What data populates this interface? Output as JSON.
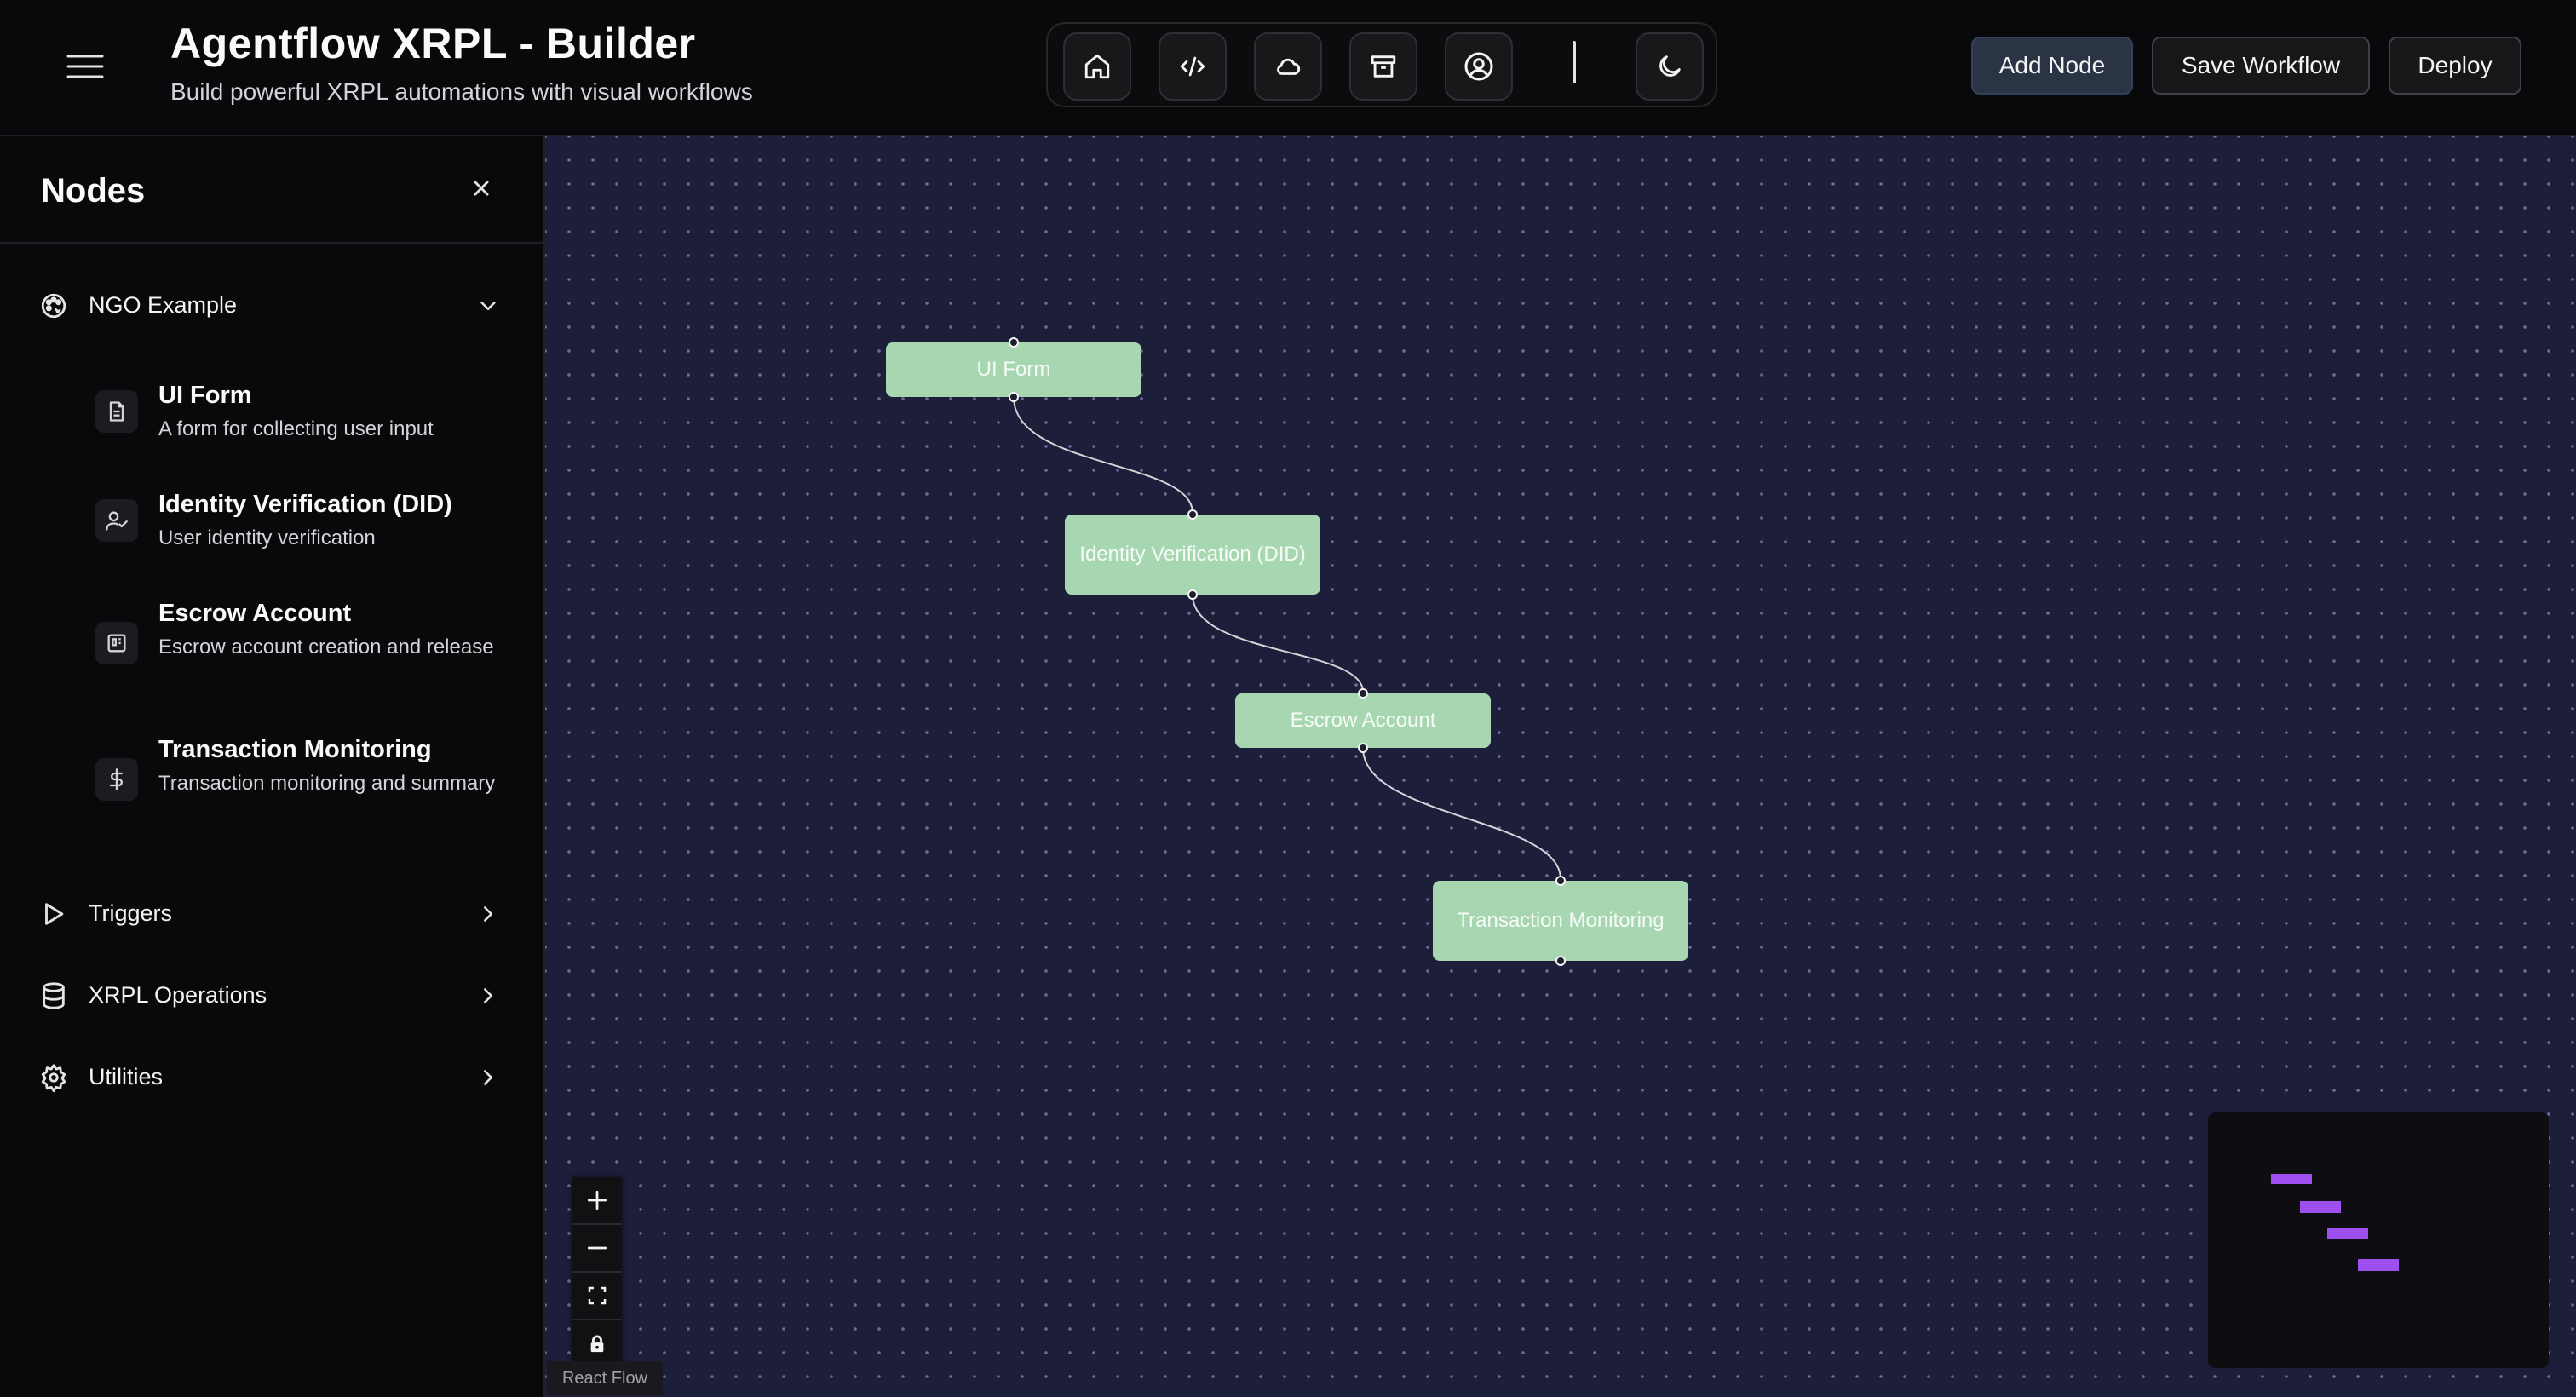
{
  "header": {
    "title": "Agentflow XRPL - Builder",
    "subtitle": "Build powerful XRPL automations with visual workflows",
    "toolbar_icons": [
      "home-icon",
      "code-icon",
      "cloud-icon",
      "archive-icon",
      "user-circle-icon",
      "moon-icon"
    ],
    "add_node_label": "Add Node",
    "save_label": "Save Workflow",
    "deploy_label": "Deploy"
  },
  "sidebar": {
    "title": "Nodes",
    "categories": [
      {
        "label": "NGO Example",
        "icon": "palette-icon",
        "expanded": true,
        "items": [
          {
            "title": "UI Form",
            "description": "A form for collecting user input",
            "icon": "file-text-icon"
          },
          {
            "title": "Identity Verification (DID)",
            "description": "User identity verification",
            "icon": "user-check-icon"
          },
          {
            "title": "Escrow Account",
            "description": "Escrow account creation and release",
            "icon": "escrow-box-icon"
          },
          {
            "title": "Transaction Monitoring",
            "description": "Transaction monitoring and summary",
            "icon": "dollar-icon"
          }
        ]
      },
      {
        "label": "Triggers",
        "icon": "play-icon",
        "expanded": false
      },
      {
        "label": "XRPL Operations",
        "icon": "database-icon",
        "expanded": false
      },
      {
        "label": "Utilities",
        "icon": "gear-icon",
        "expanded": false
      }
    ]
  },
  "canvas": {
    "nodes": [
      {
        "id": "ui-form",
        "label": "UI Form"
      },
      {
        "id": "identity-verification",
        "label": "Identity Verification (DID)"
      },
      {
        "id": "escrow-account",
        "label": "Escrow Account"
      },
      {
        "id": "transaction-monitoring",
        "label": "Transaction Monitoring"
      }
    ],
    "edges": [
      {
        "from": "ui-form",
        "to": "identity-verification"
      },
      {
        "from": "identity-verification",
        "to": "escrow-account"
      },
      {
        "from": "escrow-account",
        "to": "transaction-monitoring"
      }
    ],
    "attribution": "React Flow",
    "colors": {
      "node_fill": "#a7d7b1",
      "minimap_node": "#9d4ff0",
      "canvas_bg": "#1c1e3a"
    }
  }
}
